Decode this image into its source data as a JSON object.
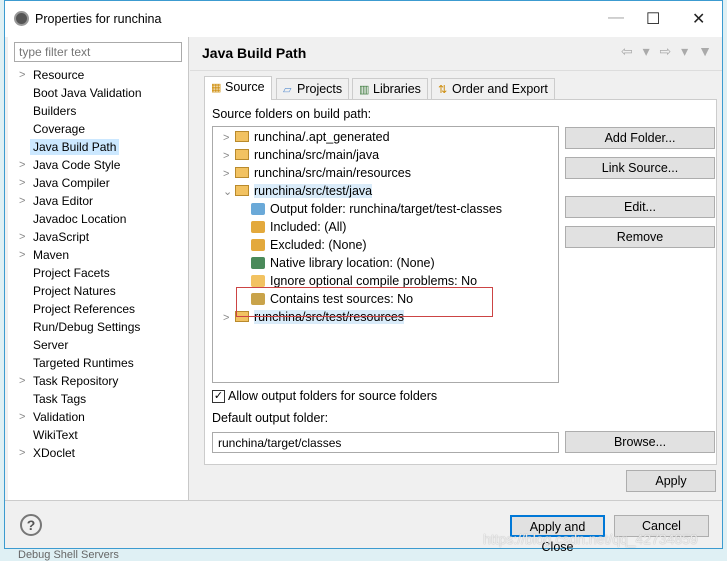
{
  "window": {
    "title": "Properties for runchina",
    "minimize": "—",
    "maximize": "☐",
    "close": "✕"
  },
  "filter": {
    "placeholder": "type filter text"
  },
  "nav": [
    {
      "label": "Resource",
      "expandable": true
    },
    {
      "label": "Boot Java Validation",
      "expandable": false
    },
    {
      "label": "Builders",
      "expandable": false
    },
    {
      "label": "Coverage",
      "expandable": false
    },
    {
      "label": "Java Build Path",
      "expandable": false,
      "selected": true
    },
    {
      "label": "Java Code Style",
      "expandable": true
    },
    {
      "label": "Java Compiler",
      "expandable": true
    },
    {
      "label": "Java Editor",
      "expandable": true
    },
    {
      "label": "Javadoc Location",
      "expandable": false
    },
    {
      "label": "JavaScript",
      "expandable": true
    },
    {
      "label": "Maven",
      "expandable": true
    },
    {
      "label": "Project Facets",
      "expandable": false
    },
    {
      "label": "Project Natures",
      "expandable": false
    },
    {
      "label": "Project References",
      "expandable": false
    },
    {
      "label": "Run/Debug Settings",
      "expandable": false
    },
    {
      "label": "Server",
      "expandable": false
    },
    {
      "label": "Targeted Runtimes",
      "expandable": false
    },
    {
      "label": "Task Repository",
      "expandable": true
    },
    {
      "label": "Task Tags",
      "expandable": false
    },
    {
      "label": "Validation",
      "expandable": true
    },
    {
      "label": "WikiText",
      "expandable": false
    },
    {
      "label": "XDoclet",
      "expandable": true
    }
  ],
  "page": {
    "title": "Java Build Path",
    "nav_arrows": "⇦ ▾ ⇨ ▾ ▼"
  },
  "tabs": [
    {
      "label": "Source",
      "active": true
    },
    {
      "label": "Projects"
    },
    {
      "label": "Libraries"
    },
    {
      "label": "Order and Export"
    }
  ],
  "source": {
    "label": "Source folders on build path:",
    "tree": [
      {
        "label": "runchina/.apt_generated",
        "level": 0,
        "expanded": false
      },
      {
        "label": "runchina/src/main/java",
        "level": 0,
        "expanded": false
      },
      {
        "label": "runchina/src/main/resources",
        "level": 0,
        "expanded": false
      },
      {
        "label": "runchina/src/test/java",
        "level": 0,
        "expanded": true,
        "selected": true
      },
      {
        "label": "Output folder: runchina/target/test-classes",
        "level": 1,
        "color": "#6aa9d8"
      },
      {
        "label": "Included: (All)",
        "level": 1,
        "color": "#e3a93c"
      },
      {
        "label": "Excluded: (None)",
        "level": 1,
        "color": "#e3a93c"
      },
      {
        "label": "Native library location: (None)",
        "level": 1,
        "color": "#4a8a5a"
      },
      {
        "label": "Ignore optional compile problems: No",
        "level": 1,
        "color": "#f2c261"
      },
      {
        "label": "Contains test sources: No",
        "level": 1,
        "color": "#c9a34a"
      },
      {
        "label": "runchina/src/test/resources",
        "level": 0,
        "expanded": false,
        "selected": true
      }
    ],
    "buttons": {
      "add_folder": "Add Folder...",
      "link_source": "Link Source...",
      "edit": "Edit...",
      "remove": "Remove"
    },
    "allow_output": "Allow output folders for source folders",
    "allow_output_checked": true,
    "default_output_label": "Default output folder:",
    "default_output_value": "runchina/target/classes",
    "browse": "Browse..."
  },
  "apply": "Apply",
  "footer": {
    "help": "?",
    "apply_close": "Apply and Close",
    "cancel": "Cancel"
  },
  "watermark": "https://blog.csdn.net/qq_42734859",
  "background_strip": "Debug Shell   Servers"
}
